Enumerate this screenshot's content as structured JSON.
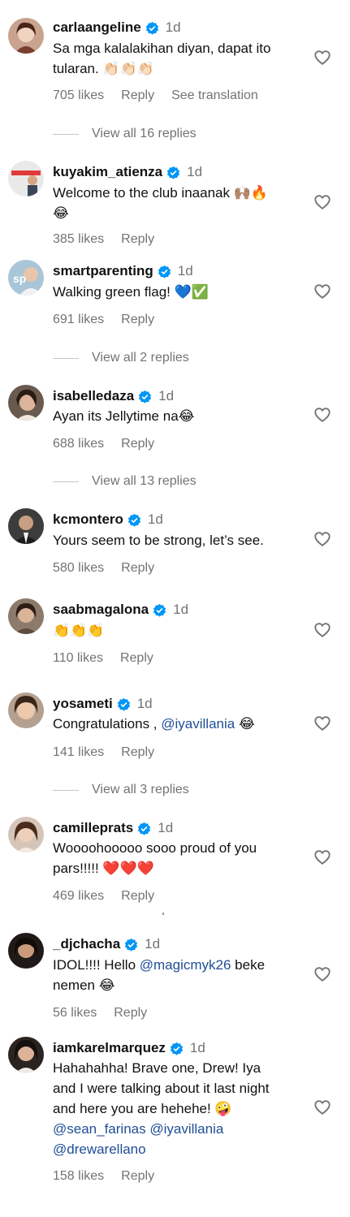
{
  "colors": {
    "accent_link": "#1f4e96",
    "verified_badge": "#0095f6",
    "secondary_text": "#737373"
  },
  "icons": {
    "verified": "verified-badge-icon",
    "like": "heart-outline-icon"
  },
  "comments": [
    {
      "username": "carlaangeline",
      "time": "1d",
      "text_lines": [
        "Sa mga kalalakihan diyan, dapat ito",
        "tularan. 👏🏻👏🏻👏🏻"
      ],
      "likes": "705 likes",
      "reply": "Reply",
      "translation": "See translation",
      "view_replies": "View all 16 replies"
    },
    {
      "username": "kuyakim_atienza",
      "time": "1d",
      "text_lines": [
        "Welcome to the club inaanak 🙌🏽🔥",
        "😂"
      ],
      "likes": "385 likes",
      "reply": "Reply"
    },
    {
      "username": "smartparenting",
      "time": "1d",
      "text_lines": [
        "Walking green flag! 💙✅"
      ],
      "likes": "691 likes",
      "reply": "Reply",
      "view_replies": "View all 2 replies"
    },
    {
      "username": "isabelledaza",
      "time": "1d",
      "text_lines": [
        "Ayan its Jellytime na😂"
      ],
      "likes": "688 likes",
      "reply": "Reply",
      "view_replies": "View all 13 replies"
    },
    {
      "username": "kcmontero",
      "time": "1d",
      "text_lines": [
        "Yours seem to be strong, let’s see."
      ],
      "likes": "580 likes",
      "reply": "Reply"
    },
    {
      "username": "saabmagalona",
      "time": "1d",
      "text_lines": [
        "👏👏👏"
      ],
      "likes": "110 likes",
      "reply": "Reply"
    },
    {
      "username": "yosameti",
      "time": "1d",
      "text_prefix": "Congratulations , ",
      "mention": "@iyavillania",
      "text_suffix": " 😂",
      "likes": "141 likes",
      "reply": "Reply",
      "view_replies": "View all 3 replies"
    },
    {
      "username": "camilleprats",
      "time": "1d",
      "text_lines": [
        "Wooooh​ooooo sooo proud of you",
        "pars!!!!! ❤️❤️❤️"
      ],
      "likes": "469 likes",
      "reply": "Reply"
    },
    {
      "username": "_djchacha",
      "time": "1d",
      "text_prefix": "IDOL!!!! Hello ",
      "mention": "@magicmyk26",
      "text_suffix": " beke",
      "text_line2": "nemen 😂",
      "likes": "56 likes",
      "reply": "Reply"
    },
    {
      "username": "iamkarelmarquez",
      "time": "1d",
      "text_lines": [
        "Hahahahha! Brave one, Drew! Iya",
        "and I were talking about it last night",
        "and here you are hehehe! 🤪"
      ],
      "mention_line_1": "@sean_farinas",
      "mention_line_2": "@iyavillania",
      "mention_line_3": "@drewarellano",
      "likes": "158 likes",
      "reply": "Reply"
    }
  ]
}
